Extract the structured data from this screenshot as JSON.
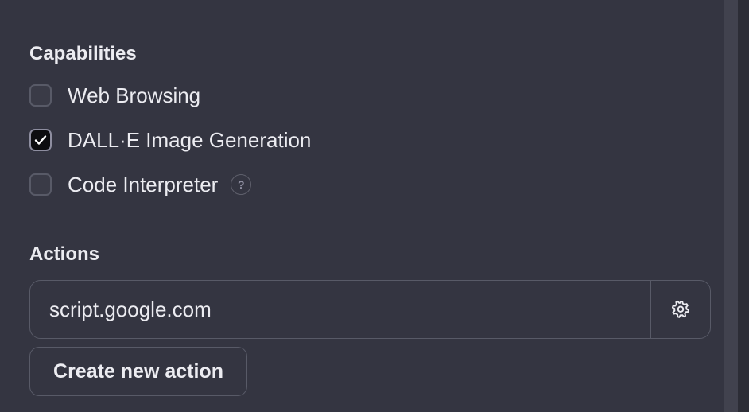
{
  "capabilities": {
    "title": "Capabilities",
    "items": [
      {
        "label": "Web Browsing",
        "checked": false
      },
      {
        "label": "DALL·E Image Generation",
        "checked": true
      },
      {
        "label": "Code Interpreter",
        "checked": false,
        "help": "?"
      }
    ]
  },
  "actions": {
    "title": "Actions",
    "items": [
      {
        "domain": "script.google.com"
      }
    ],
    "create_label": "Create new action"
  },
  "colors": {
    "background": "#343541",
    "text": "#ececf1",
    "border": "#585a67",
    "checked_fill": "#0d0d10"
  },
  "icons": {
    "check": "checkmark-icon",
    "help": "question-circle-icon",
    "settings": "gear-icon"
  }
}
